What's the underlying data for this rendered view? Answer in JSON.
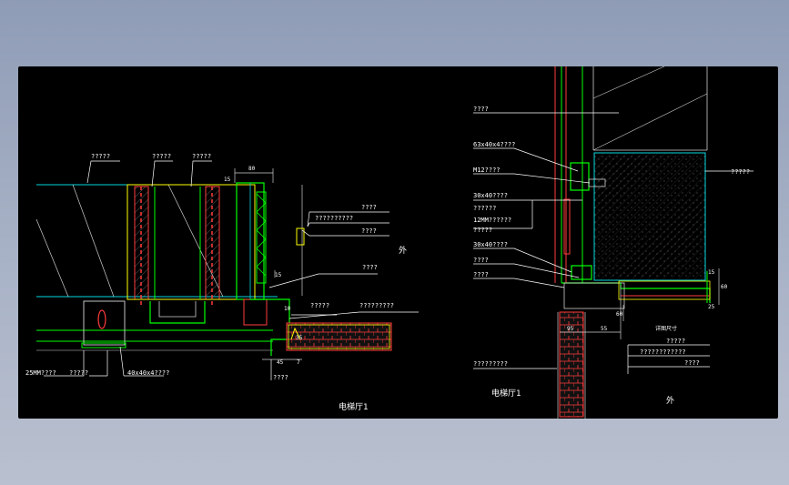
{
  "drawing": {
    "left_detail": {
      "top_labels": [
        "?????",
        "?????",
        "?????"
      ],
      "right_labels": [
        "????",
        "??????????",
        "????",
        "????",
        "?????",
        "?????????"
      ],
      "bottom_labels": [
        "25MM????",
        "?????",
        "40x40x4????",
        "????"
      ],
      "dims": [
        "80",
        "15",
        "10",
        "45",
        "7",
        "35",
        "15"
      ],
      "side_mark": "外",
      "caption": "电梯厅1"
    },
    "right_detail": {
      "left_labels": [
        "????",
        "63x40x4????",
        "M12????",
        "30x40????",
        "??????",
        "12MM??????",
        "?????",
        "30x40????",
        "????",
        "????",
        "?????????"
      ],
      "right_labels": [
        "?????",
        "?????",
        "????????????",
        "????"
      ],
      "dims": [
        "95",
        "55",
        "60",
        "15",
        "60",
        "25"
      ],
      "dim_note": "详图尺寸",
      "side_mark": "外",
      "caption": "电梯厅1"
    }
  },
  "colors": {
    "background": "#000000",
    "frame": "#8f9cb6",
    "leader": "#ffffff",
    "structure": "#00ff00",
    "wall": "#ff3333",
    "cyan": "#00d8e0",
    "yellow": "#ffff00"
  }
}
